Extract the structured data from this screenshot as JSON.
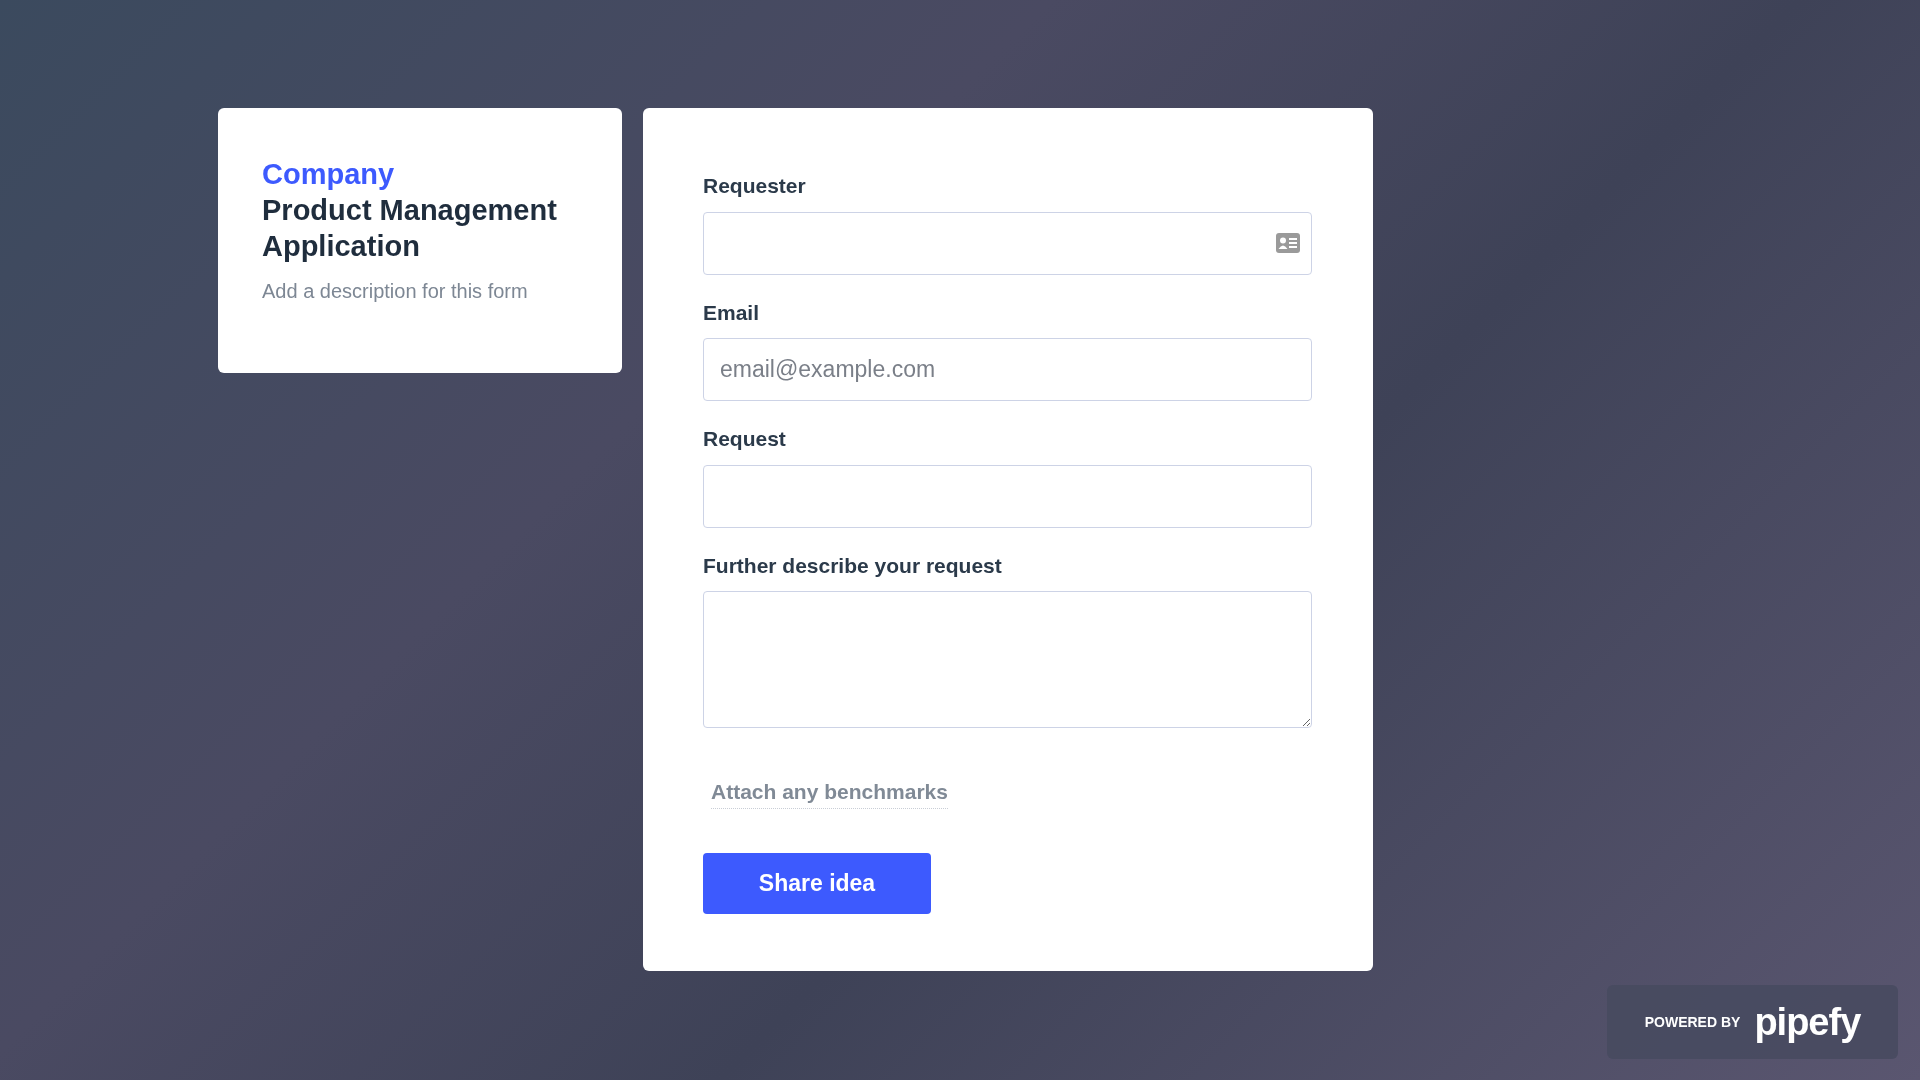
{
  "header_card": {
    "company": "Company",
    "title": "Product Management Application",
    "description": "Add a description for this form"
  },
  "form": {
    "fields": [
      {
        "kind": "contact",
        "label": "Requester"
      },
      {
        "kind": "input",
        "label": "Email",
        "placeholder": "email@example.com"
      },
      {
        "kind": "input",
        "label": "Request"
      },
      {
        "kind": "textarea",
        "label": "Further describe your request"
      }
    ],
    "attachment_link": "Attach any benchmarks",
    "submit_button": "Share idea"
  },
  "footer_badge": {
    "prefix": "POWERED BY",
    "brand": "pipefy"
  }
}
